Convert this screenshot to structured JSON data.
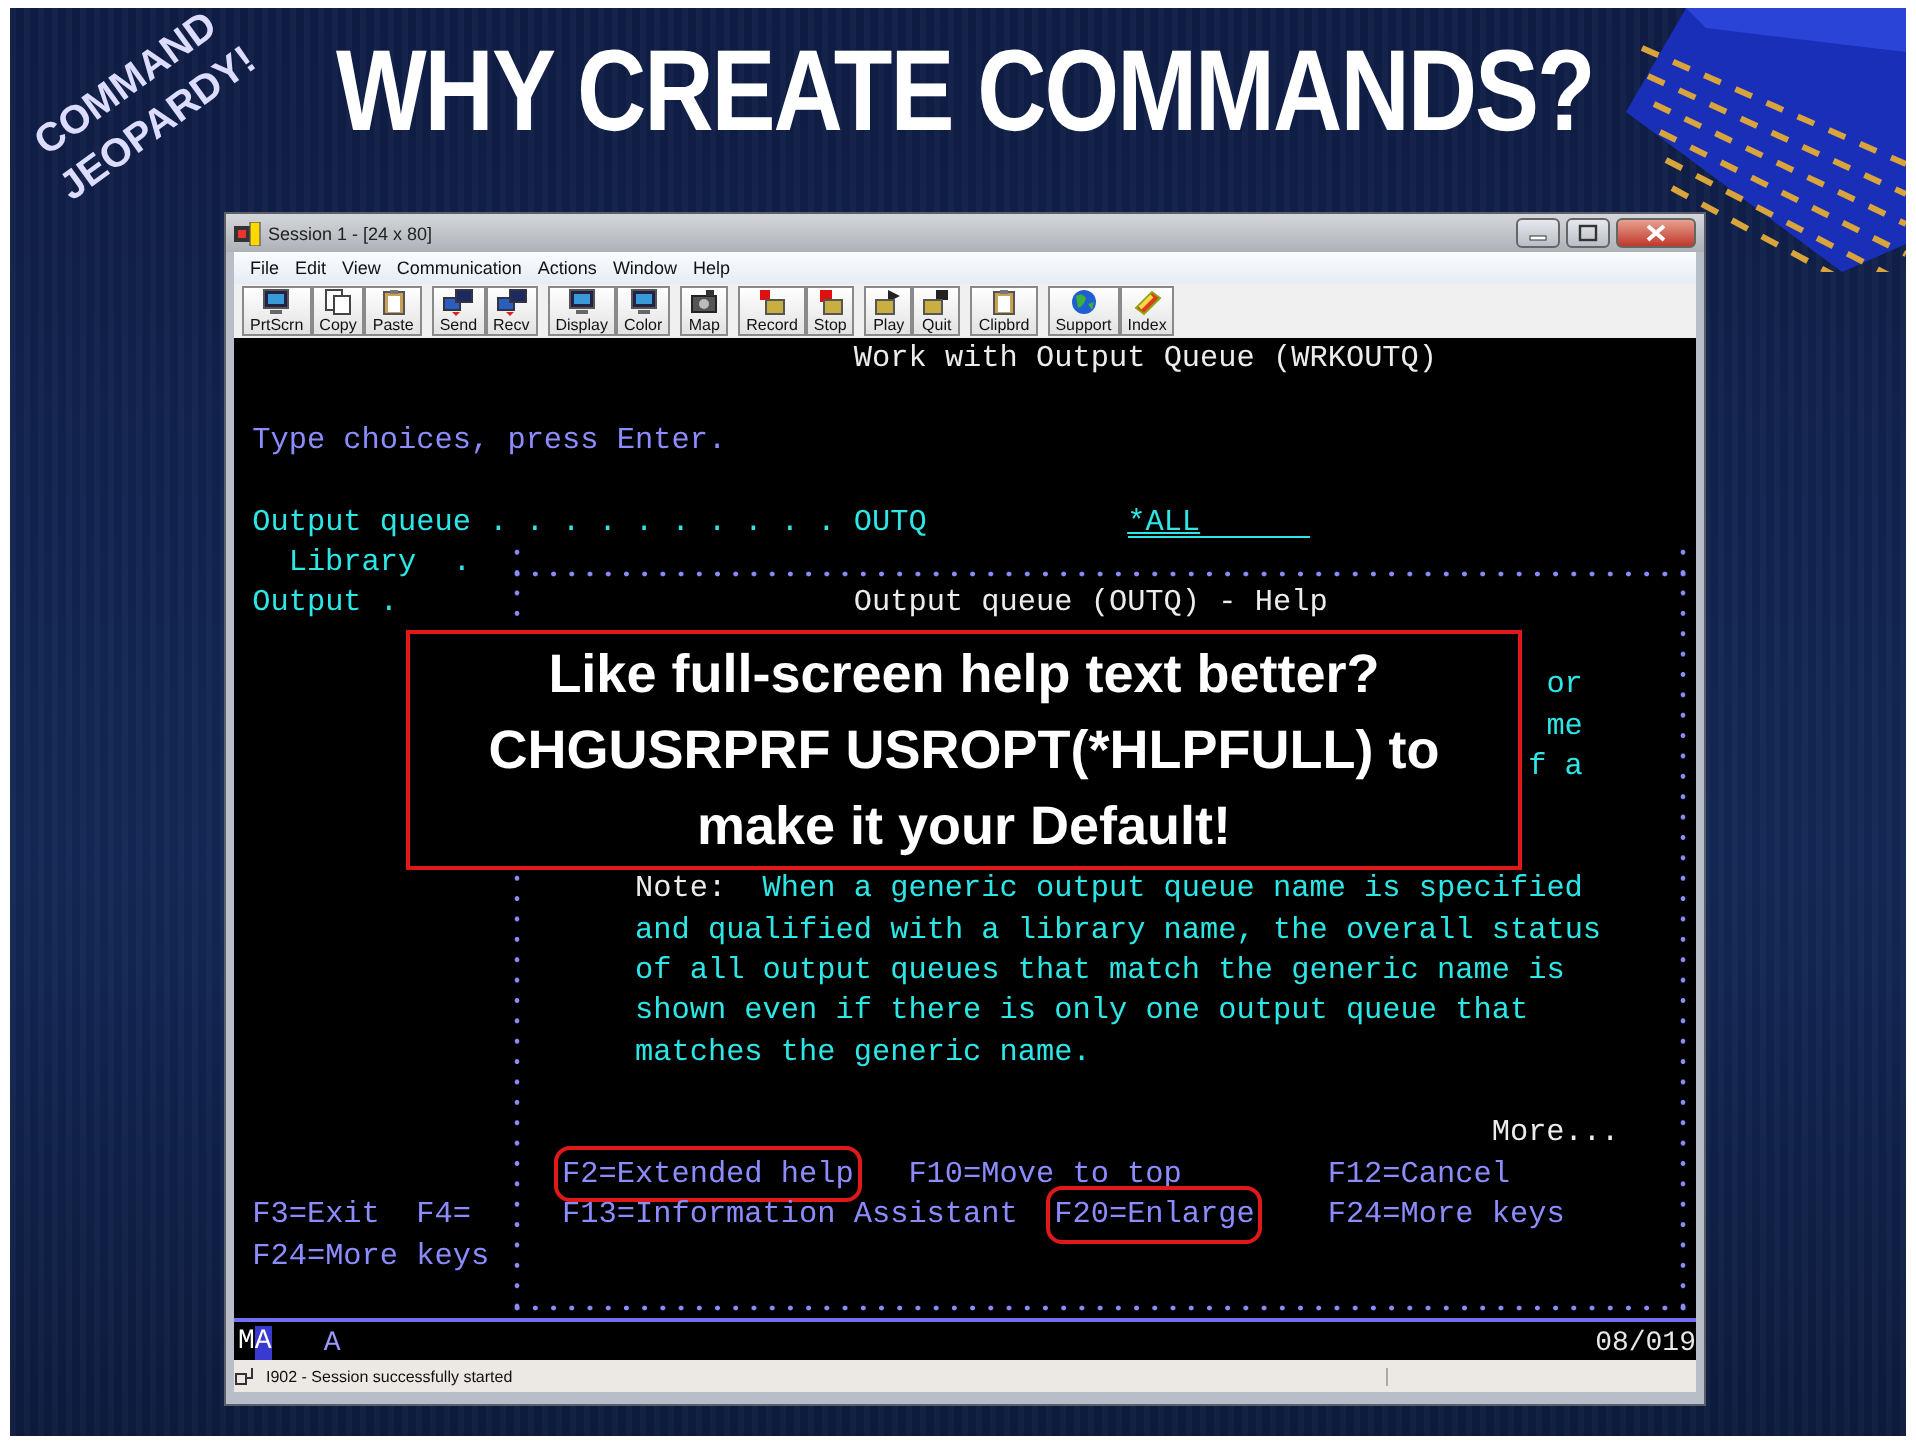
{
  "slide": {
    "badge": [
      "COMMAND",
      "JEOPARDY!"
    ],
    "title": "WHY CREATE COMMANDS?"
  },
  "window": {
    "title": "Session 1 - [24 x 80]",
    "menu": [
      "File",
      "Edit",
      "View",
      "Communication",
      "Actions",
      "Window",
      "Help"
    ],
    "toolbar": [
      [
        "PrtScrn",
        "Copy",
        "Paste"
      ],
      [
        "Send",
        "Recv"
      ],
      [
        "Display",
        "Color"
      ],
      [
        "Map"
      ],
      [
        "Record",
        "Stop"
      ],
      [
        "Play",
        "Quit"
      ],
      [
        "Clipbrd"
      ],
      [
        "Support",
        "Index"
      ]
    ]
  },
  "screen": {
    "texts": [
      {
        "text": "Work with Output Queue (WRKOUTQ)",
        "kind": "heading"
      },
      {
        "text": "Type choices, press Enter.",
        "kind": "prompt"
      },
      {
        "text": "Output queue . . . . . . . . . .",
        "kind": "label"
      },
      {
        "text": "OUTQ",
        "kind": "label"
      },
      {
        "text": "*ALL",
        "kind": "input"
      },
      {
        "text": "Library  .",
        "kind": "label"
      },
      {
        "text": "Output .",
        "kind": "label"
      },
      {
        "text": "F3=Exit",
        "kind": "key"
      },
      {
        "text": "F4=",
        "kind": "key"
      },
      {
        "text": "F24=More keys",
        "kind": "key"
      }
    ]
  },
  "help": {
    "texts": [
      {
        "text": "Output queue (OUTQ) - Help",
        "kind": "heading"
      },
      {
        "text": "or",
        "kind": "body"
      },
      {
        "text": "me",
        "kind": "body"
      },
      {
        "text": "f a",
        "kind": "body"
      },
      {
        "text": "Note:",
        "kind": "heading"
      },
      {
        "text": "When a generic output queue name is specified",
        "kind": "body"
      },
      {
        "text": "and qualified with a library name, the overall status",
        "kind": "body"
      },
      {
        "text": "of all output queues that match the generic name is",
        "kind": "body"
      },
      {
        "text": "shown even if there is only one output queue that",
        "kind": "body"
      },
      {
        "text": "matches the generic name.",
        "kind": "body"
      },
      {
        "text": "More...",
        "kind": "heading"
      }
    ],
    "keys": [
      {
        "text": "F2=Extended help",
        "highlighted": true
      },
      {
        "text": "F10=Move to top",
        "highlighted": false
      },
      {
        "text": "F12=Cancel",
        "highlighted": false
      },
      {
        "text": "F13=Information Assistant",
        "highlighted": false
      },
      {
        "text": "F20=Enlarge",
        "highlighted": true
      },
      {
        "text": "F24=More keys",
        "highlighted": false
      }
    ]
  },
  "callout": {
    "text": "Like full-screen help text better? CHGUSRPRF USROPT(*HLPFULL) to make it your Default!"
  },
  "status": {
    "mode": "MA",
    "indicator": "A",
    "position": "08/019"
  },
  "status_bar": {
    "message": "I902 - Session successfully started"
  }
}
